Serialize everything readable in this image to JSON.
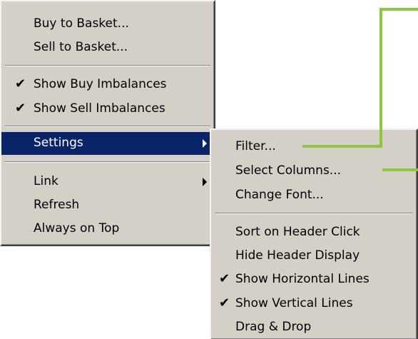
{
  "main_menu": {
    "items": [
      {
        "label": "Buy to Basket...",
        "checked": false
      },
      {
        "label": "Sell to Basket...",
        "checked": false
      },
      {
        "label": "Show Buy Imbalances",
        "checked": true
      },
      {
        "label": "Show Sell Imbalances",
        "checked": true
      },
      {
        "label": "Settings",
        "submenu": true,
        "selected": true
      },
      {
        "label": "Link",
        "submenu": true
      },
      {
        "label": "Refresh"
      },
      {
        "label": "Always on Top"
      }
    ]
  },
  "settings_submenu": {
    "items": [
      {
        "label": "Filter..."
      },
      {
        "label": "Select Columns..."
      },
      {
        "label": "Change Font..."
      },
      {
        "label": "Sort on Header Click"
      },
      {
        "label": "Hide Header Display"
      },
      {
        "label": "Show Horizontal Lines",
        "checked": true
      },
      {
        "label": "Show Vertical Lines",
        "checked": true
      },
      {
        "label": "Drag & Drop"
      }
    ]
  },
  "glyphs": {
    "check": "✔"
  },
  "colors": {
    "menu_bg": "#d4d0c8",
    "highlight": "#0a246a",
    "callout_line": "#8dc63f"
  }
}
